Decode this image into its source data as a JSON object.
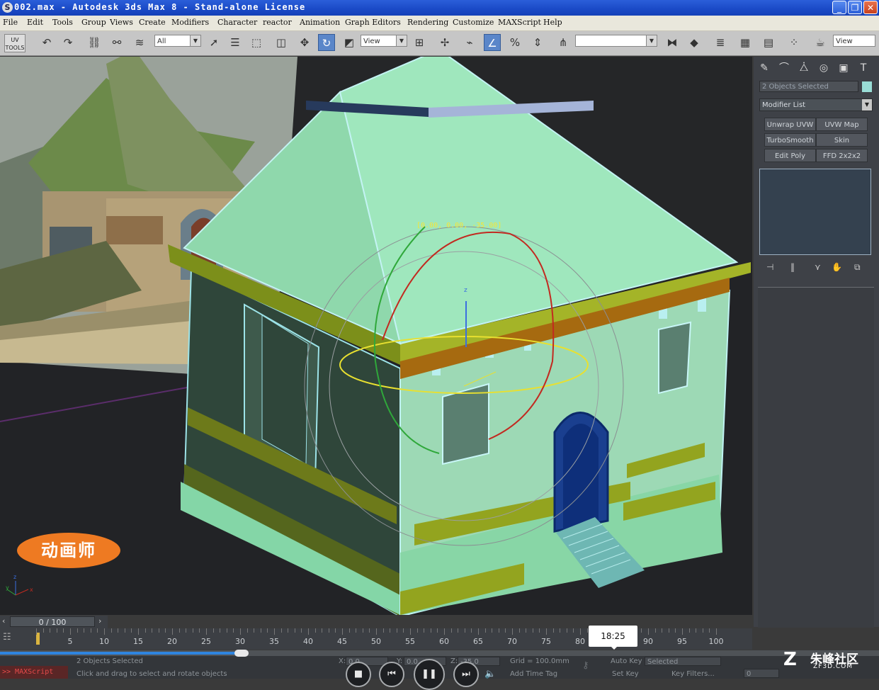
{
  "window": {
    "title": "002.max - Autodesk 3ds Max 8  - Stand-alone License",
    "app_icon_glyph": "S",
    "minimize_glyph": "_",
    "restore_glyph": "❐",
    "close_glyph": "✕"
  },
  "menu": {
    "items": [
      "File",
      "Edit",
      "Tools",
      "Group",
      "Views",
      "Create",
      "Modifiers",
      "Character",
      "reactor",
      "Animation",
      "Graph Editors",
      "Rendering",
      "Customize",
      "MAXScript",
      "Help"
    ]
  },
  "toolbar": {
    "uv_tools_line1": "UV",
    "uv_tools_line2": "TOOLS",
    "selection_filter": "All",
    "ref_coord_1": "View",
    "ref_coord_2": "View",
    "named_selection": "",
    "icons": [
      "undo-icon",
      "redo-icon",
      "select-link-icon",
      "unlink-icon",
      "bind-space-warp-icon",
      "select-icon",
      "select-by-name-icon",
      "rect-region-icon",
      "window-crossing-icon",
      "move-icon",
      "rotate-icon",
      "scale-icon",
      "pivot-icon",
      "manipulate-icon",
      "snap-3d-icon",
      "angle-snap-icon",
      "percent-snap-icon",
      "spinner-snap-icon",
      "edit-named-selection-icon",
      "mirror-icon",
      "align-icon",
      "layer-manager-icon",
      "curve-editor-icon",
      "schematic-view-icon",
      "material-editor-icon",
      "render-scene-icon"
    ]
  },
  "viewport": {
    "gizmo_coordinates": "[0.00, 0.00, -35.00]",
    "axis_z_label": "z",
    "axis_tripod_labels": [
      "x",
      "y",
      "z"
    ],
    "watermark_logo_text": "动画师"
  },
  "command_panel": {
    "tabs": [
      "create-tab",
      "modify-tab",
      "hierarchy-tab",
      "motion-tab",
      "display-tab",
      "utilities-tab"
    ],
    "selection_name": "2 Objects Selected",
    "selection_color": "#99ddd6",
    "modifier_list_label": "Modifier List",
    "modifier_buttons": [
      "Unwrap UVW",
      "UVW Map",
      "TurboSmooth",
      "Skin",
      "Edit Poly",
      "FFD 2x2x2"
    ]
  },
  "timeline": {
    "frame_counter": "0 / 100",
    "ruler_labels": [
      "0",
      "5",
      "10",
      "15",
      "20",
      "25",
      "30",
      "35",
      "40",
      "45",
      "50",
      "55",
      "60",
      "65",
      "70",
      "75",
      "80",
      "85",
      "90",
      "95",
      "100"
    ],
    "current_frame": 0,
    "video_tooltip_time": "18:25",
    "video_progress_fraction": 0.274
  },
  "statusbar": {
    "maxscript_label": ">> MAXScript",
    "selection_status": "2 Objects Selected",
    "prompt": "Click and drag to select and rotate objects",
    "x_value": "0.0",
    "y_value": "0.0",
    "z_value": "-35.0",
    "grid": "Grid = 100.0mm",
    "add_time_tag": "Add Time Tag",
    "auto_key": "Auto Key",
    "set_key": "Set Key",
    "selected_dropdown": "Selected",
    "key_filters": "Key Filters...",
    "frame_field": "0",
    "labels": {
      "x": "X:",
      "y": "Y:",
      "z": "Z:"
    }
  },
  "video_controls": [
    "stop-icon",
    "prev-icon",
    "pause-icon",
    "next-icon",
    "volume-icon"
  ],
  "watermark": {
    "site_name": "朱峰社区",
    "site_url": "ZF3D.COM",
    "logo_glyph": "Z"
  }
}
